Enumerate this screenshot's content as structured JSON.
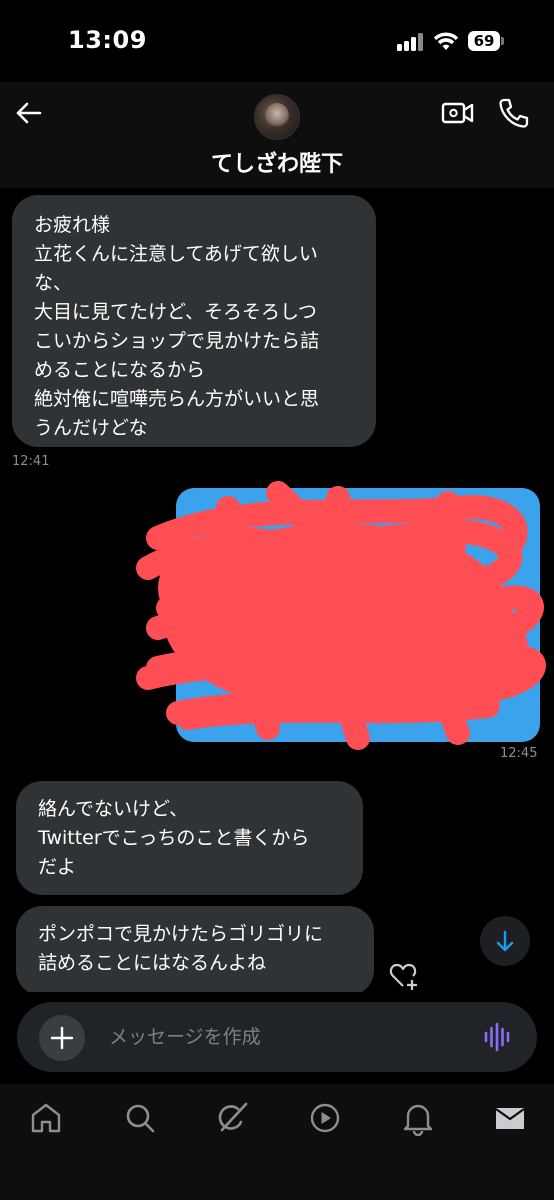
{
  "status_bar": {
    "time": "13:09",
    "battery": "69"
  },
  "header": {
    "contact_name": "てしざわ陛下"
  },
  "messages": [
    {
      "direction": "incoming",
      "lines": [
        "お疲れ様",
        "立花くんに注意してあげて欲しい",
        "な、",
        "大目に見てたけど、そろそろしつ",
        "こいからショップで見かけたら詰",
        "めることになるから",
        "絶対俺に喧嘩売らん方がいいと思",
        "うんだけどな"
      ],
      "time": "12:41"
    },
    {
      "direction": "outgoing",
      "type": "image",
      "redacted": true,
      "time": "12:45"
    },
    {
      "direction": "incoming",
      "lines": [
        "絡んでないけど、",
        "Twitterでこっちのこと書くから",
        "だよ"
      ]
    },
    {
      "direction": "incoming",
      "lines": [
        "ポンポコで見かけたらゴリゴリに",
        "詰めることにはなるんよね"
      ]
    }
  ],
  "composer": {
    "placeholder": "メッセージを作成"
  },
  "nav": {
    "items": [
      "home-icon",
      "search-icon",
      "grok-icon",
      "play-icon",
      "bell-icon",
      "mail-icon"
    ]
  },
  "colors": {
    "accent": "#1d9bf0",
    "bubble": "#2f3336",
    "voice": "#8b6cf6",
    "scribble": "#ff4f55"
  }
}
